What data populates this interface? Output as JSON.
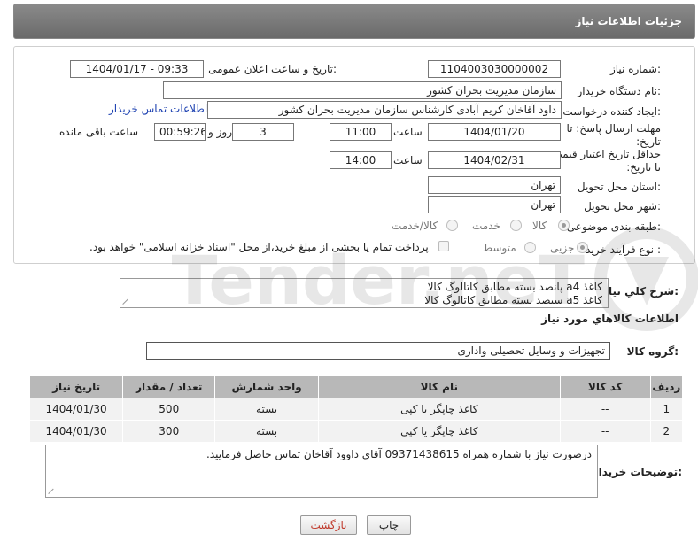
{
  "header": {
    "title": "جزئیات اطلاعات نیاز"
  },
  "form": {
    "need_number_label": "شماره نیاز:",
    "need_number": "1104003030000002",
    "announce_label": "تاریخ و ساعت اعلان عمومی:",
    "announce_value": "1404/01/17 - 09:33",
    "buyer_org_label": "نام دستگاه خریدار:",
    "buyer_org": "سازمان مدیریت بحران کشور",
    "creator_label": "ایجاد کننده درخواست:",
    "creator": "داود آقاخان کریم آبادی کارشناس سازمان مدیریت بحران کشور",
    "contact_link": "اطلاعات تماس خریدار",
    "reply_deadline_label": "مهلت ارسال پاسخ: تا تاریخ:",
    "reply_date": "1404/01/20",
    "time_label": "ساعت",
    "reply_time": "11:00",
    "days_count": "3",
    "day_and_label": "روز و",
    "remaining_time": "00:59:26",
    "remaining_label": "ساعت باقی مانده",
    "price_validity_label": "حداقل تاریخ اعتبار قیمت: تا تاریخ:",
    "validity_date": "1404/02/31",
    "validity_time": "14:00",
    "province_label": "استان محل تحویل:",
    "province": "تهران",
    "city_label": "شهر محل تحویل:",
    "city": "تهران",
    "category_label": "طبقه بندی موضوعی:",
    "category_options": [
      "کالا",
      "خدمت",
      "کالا/خدمت"
    ],
    "category_selected": "کالا",
    "process_label": "نوع فرآیند خرید :",
    "process_options": [
      "جزیی",
      "متوسط"
    ],
    "payment_note": "پرداخت تمام یا بخشی از مبلغ خرید،از محل \"اسناد خزانه اسلامی\" خواهد بود."
  },
  "description": {
    "label": "شرح کلي نياز:",
    "lines": [
      "کاغذ a4 پانصد بسته مطابق کاتالوگ کالا",
      "کاغذ a5 سیصد بسته مطابق کاتالوگ کالا"
    ]
  },
  "goods": {
    "section_title": "اطلاعات کالاهاي مورد نياز",
    "group_label": "گروه کالا:",
    "group_value": "تجهیزات و وسایل تحصیلی واداری",
    "columns": [
      "ردیف",
      "کد کالا",
      "نام کالا",
      "واحد شمارش",
      "تعداد / مقدار",
      "تاریخ نیاز"
    ],
    "rows": [
      {
        "row": "1",
        "code": "--",
        "name": "کاغذ چاپگر یا کپی",
        "unit": "بسته",
        "qty": "500",
        "date": "1404/01/30"
      },
      {
        "row": "2",
        "code": "--",
        "name": "کاغذ چاپگر یا کپی",
        "unit": "بسته",
        "qty": "300",
        "date": "1404/01/30"
      }
    ]
  },
  "notes": {
    "label": "توضیحات خریدار:",
    "text": "درصورت نیاز با شماره همراه 09371438615 آقای داوود آقاخان تماس حاصل فرمایید."
  },
  "buttons": {
    "print": "چاپ",
    "back": "بازگشت"
  },
  "watermark": {
    "text": "AriaTender.neT"
  }
}
